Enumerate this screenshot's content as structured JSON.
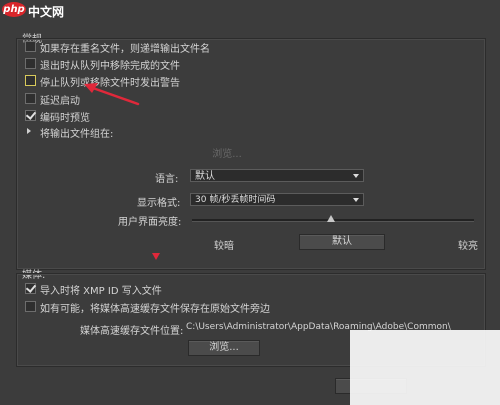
{
  "watermark": {
    "brand": "php",
    "site": "中文网"
  },
  "general": {
    "section_title": "常规",
    "options": [
      {
        "label": "如果存在重名文件，则递增输出文件名",
        "checked": false
      },
      {
        "label": "退出时从队列中移除完成的文件",
        "checked": false
      },
      {
        "label": "停止队列或移除文件时发出警告",
        "checked": false
      },
      {
        "label": "延迟启动",
        "checked": false
      },
      {
        "label": "编码时预览",
        "checked": true
      }
    ],
    "expander": "将输出文件组在:",
    "browse_disabled": "浏览..."
  },
  "language": {
    "label": "语言:",
    "value": "默认"
  },
  "display_format": {
    "label": "显示格式:",
    "value": "30 帧/秒丢帧时间码"
  },
  "brightness": {
    "label": "用户界面亮度:",
    "dark": "较暗",
    "default_button": "默认",
    "bright": "较亮",
    "level": 0.55
  },
  "media": {
    "section_title": "媒体:",
    "options": [
      {
        "label": "导入时将 XMP ID 写入文件",
        "checked": true
      },
      {
        "label": "如有可能，将媒体高速缓存文件保存在原始文件旁边",
        "checked": false
      }
    ],
    "cache_label": "媒体高速缓存文件位置:",
    "cache_path": "C:\\Users\\Administrator\\AppData\\Roaming\\Adobe\\Common\\",
    "browse_button": "浏览..."
  },
  "colors": {
    "annotation_arrow": "#e0283a"
  }
}
